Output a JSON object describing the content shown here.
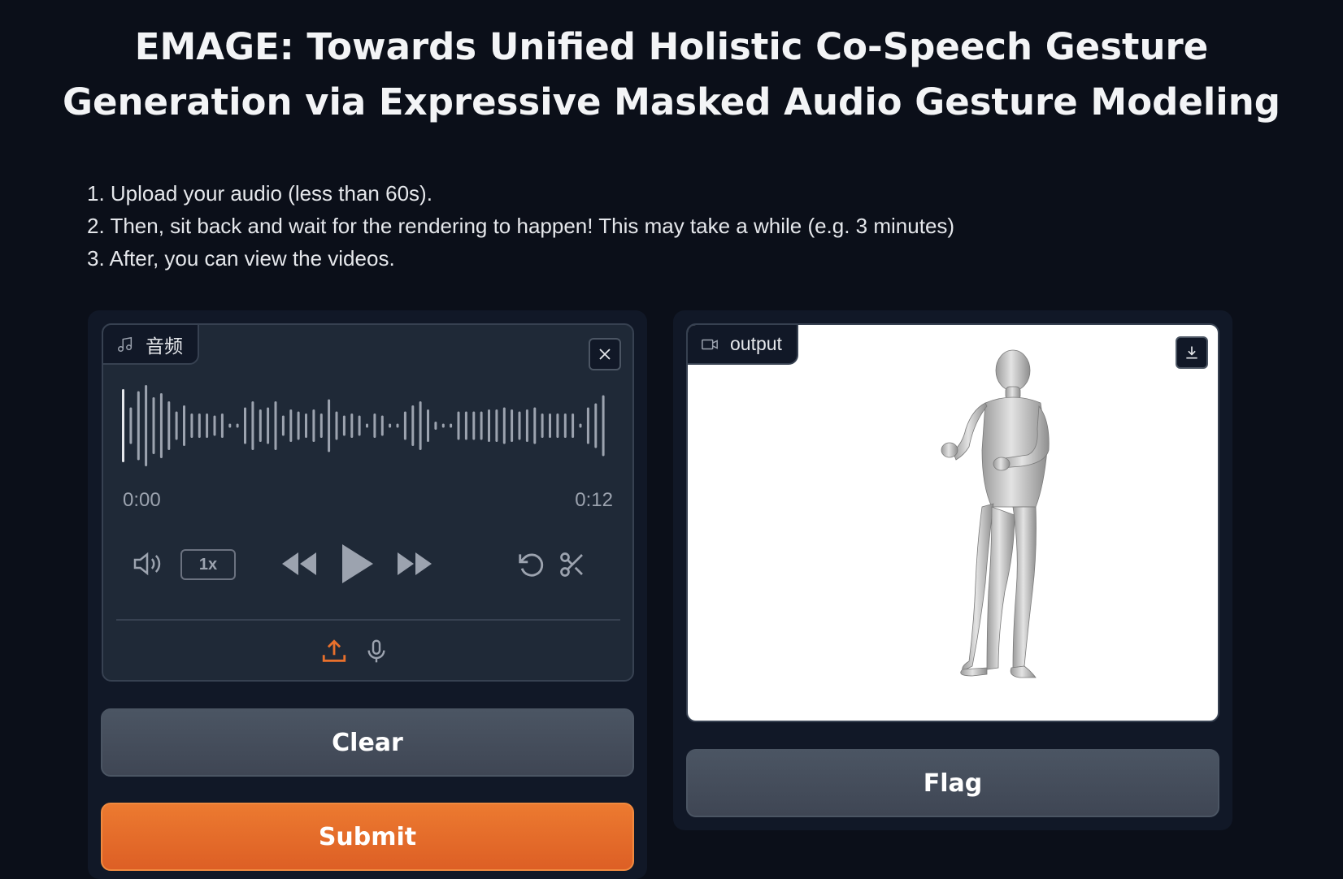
{
  "header": {
    "title_line1": "EMAGE: Towards Unified Holistic Co-Speech Gesture",
    "title_line2": "Generation via Expressive Masked Audio Gesture Modeling"
  },
  "instructions": [
    "1. Upload your audio (less than 60s).",
    "2. Then, sit back and wait for the rendering to happen! This may take a while (e.g. 3 minutes)",
    "3. After, you can view the videos."
  ],
  "audio_input": {
    "label": "音频",
    "time_current": "0:00",
    "time_total": "0:12",
    "playback_speed": "1x",
    "icons": [
      "music-icon",
      "close-icon",
      "volume-icon",
      "rewind-icon",
      "play-icon",
      "fast-forward-icon",
      "undo-icon",
      "scissors-icon",
      "upload-icon",
      "microphone-icon"
    ],
    "waveform": [
      0.9,
      0.45,
      0.85,
      1.0,
      0.7,
      0.8,
      0.6,
      0.35,
      0.5,
      0.3,
      0.3,
      0.3,
      0.25,
      0.3,
      0.05,
      0.05,
      0.45,
      0.6,
      0.4,
      0.45,
      0.6,
      0.25,
      0.4,
      0.35,
      0.3,
      0.4,
      0.3,
      0.65,
      0.35,
      0.25,
      0.3,
      0.25,
      0.05,
      0.3,
      0.25,
      0.05,
      0.05,
      0.35,
      0.5,
      0.6,
      0.4,
      0.1,
      0.05,
      0.05,
      0.35,
      0.35,
      0.35,
      0.35,
      0.4,
      0.4,
      0.45,
      0.4,
      0.35,
      0.4,
      0.45,
      0.3,
      0.3,
      0.3,
      0.3,
      0.3,
      0.05,
      0.45,
      0.55,
      0.75
    ]
  },
  "output": {
    "label": "output",
    "icons": [
      "video-camera-icon",
      "download-icon"
    ]
  },
  "buttons": {
    "clear": "Clear",
    "submit": "Submit",
    "flag": "Flag"
  },
  "colors": {
    "background": "#0b0f19",
    "panel": "#111827",
    "accent": "#e8702c",
    "waveform": "#9ca3af"
  }
}
